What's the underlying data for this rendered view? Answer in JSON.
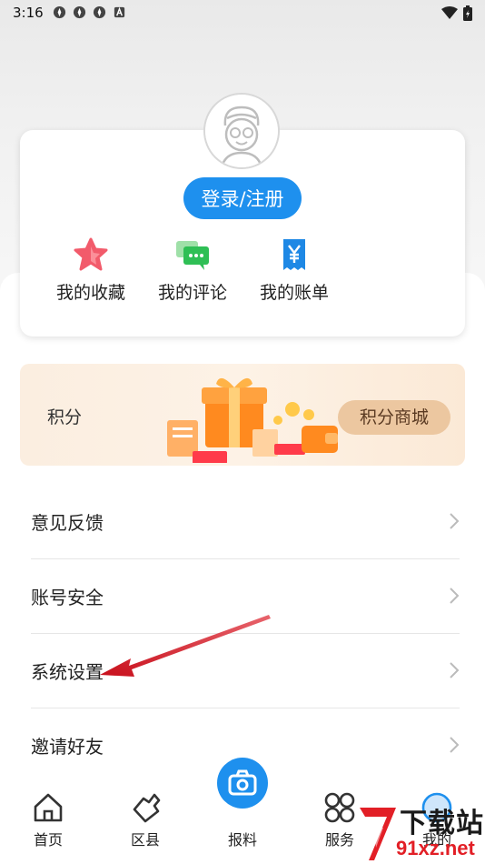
{
  "status": {
    "time": "3:16"
  },
  "profile": {
    "login_label": "登录/注册",
    "quick_actions": [
      {
        "label": "我的收藏",
        "icon": "star-icon"
      },
      {
        "label": "我的评论",
        "icon": "comment-icon"
      },
      {
        "label": "我的账单",
        "icon": "bill-icon"
      }
    ]
  },
  "points": {
    "label": "积分",
    "mall_label": "积分商城"
  },
  "menu": [
    {
      "label": "意见反馈"
    },
    {
      "label": "账号安全"
    },
    {
      "label": "系统设置"
    },
    {
      "label": "邀请好友"
    }
  ],
  "nav": {
    "items": [
      {
        "label": "首页",
        "icon": "home-icon"
      },
      {
        "label": "区县",
        "icon": "county-icon"
      },
      {
        "label": "报料",
        "icon": "camera-icon"
      },
      {
        "label": "服务",
        "icon": "services-icon"
      },
      {
        "label": "我的",
        "icon": "profile-icon"
      }
    ]
  },
  "watermark": {
    "top": "下载站",
    "bottom": "91xz.net"
  },
  "colors": {
    "primary": "#1e90ee",
    "accent_red": "#e21f26",
    "mall_button": "#ecc7a0"
  }
}
